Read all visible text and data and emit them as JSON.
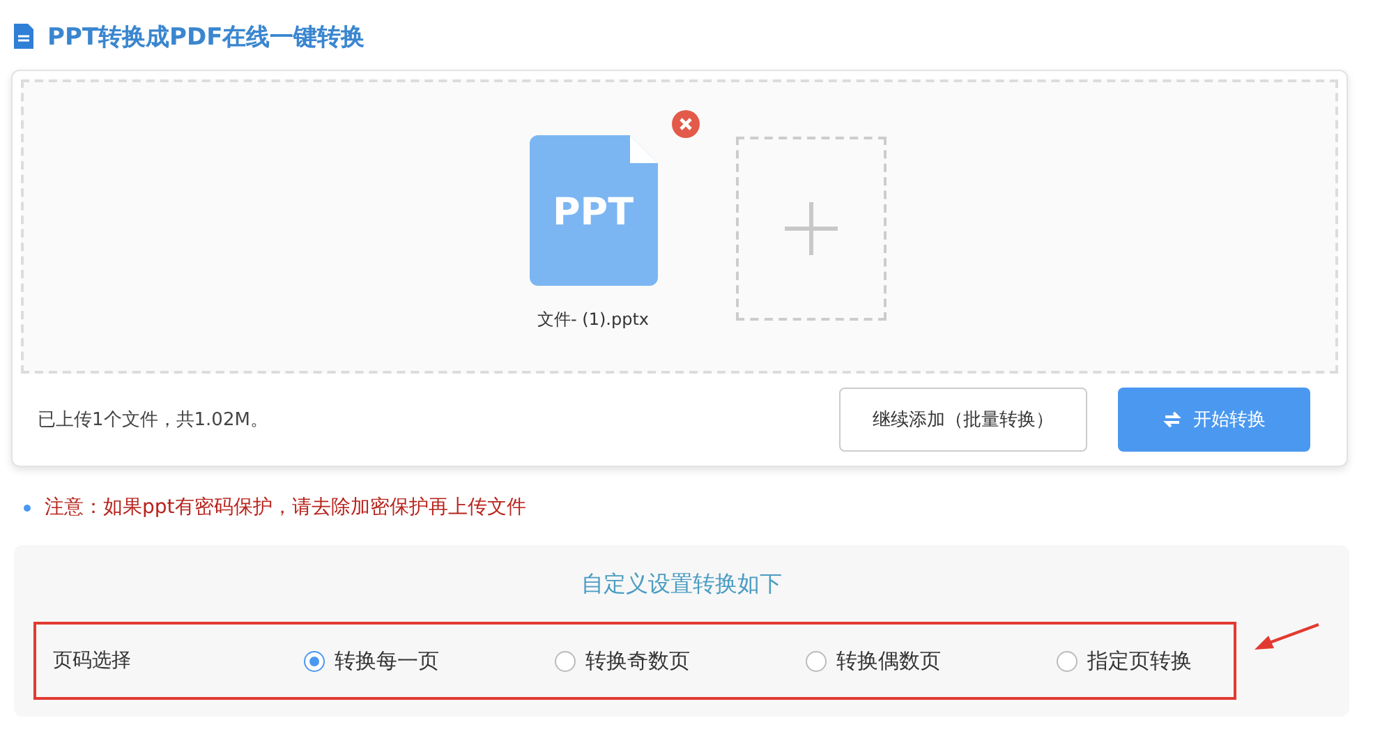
{
  "title": "PPT转换成PDF在线一键转换",
  "upload": {
    "files": [
      {
        "icon_text": "PPT",
        "name": "文件- (1).pptx"
      }
    ],
    "summary": "已上传1个文件，共1.02M。",
    "buttons": [
      {
        "label": "继续添加（批量转换）",
        "kind": "secondary"
      },
      {
        "label": "开始转换",
        "kind": "primary"
      }
    ]
  },
  "notice": "注意：如果ppt有密码保护，请去除加密保护再上传文件",
  "settings": {
    "heading": "自定义设置转换如下",
    "label": "页码选择",
    "options": [
      {
        "label": "转换每一页",
        "selected": true
      },
      {
        "label": "转换奇数页",
        "selected": false
      },
      {
        "label": "转换偶数页",
        "selected": false
      },
      {
        "label": "指定页转换",
        "selected": false
      }
    ]
  }
}
